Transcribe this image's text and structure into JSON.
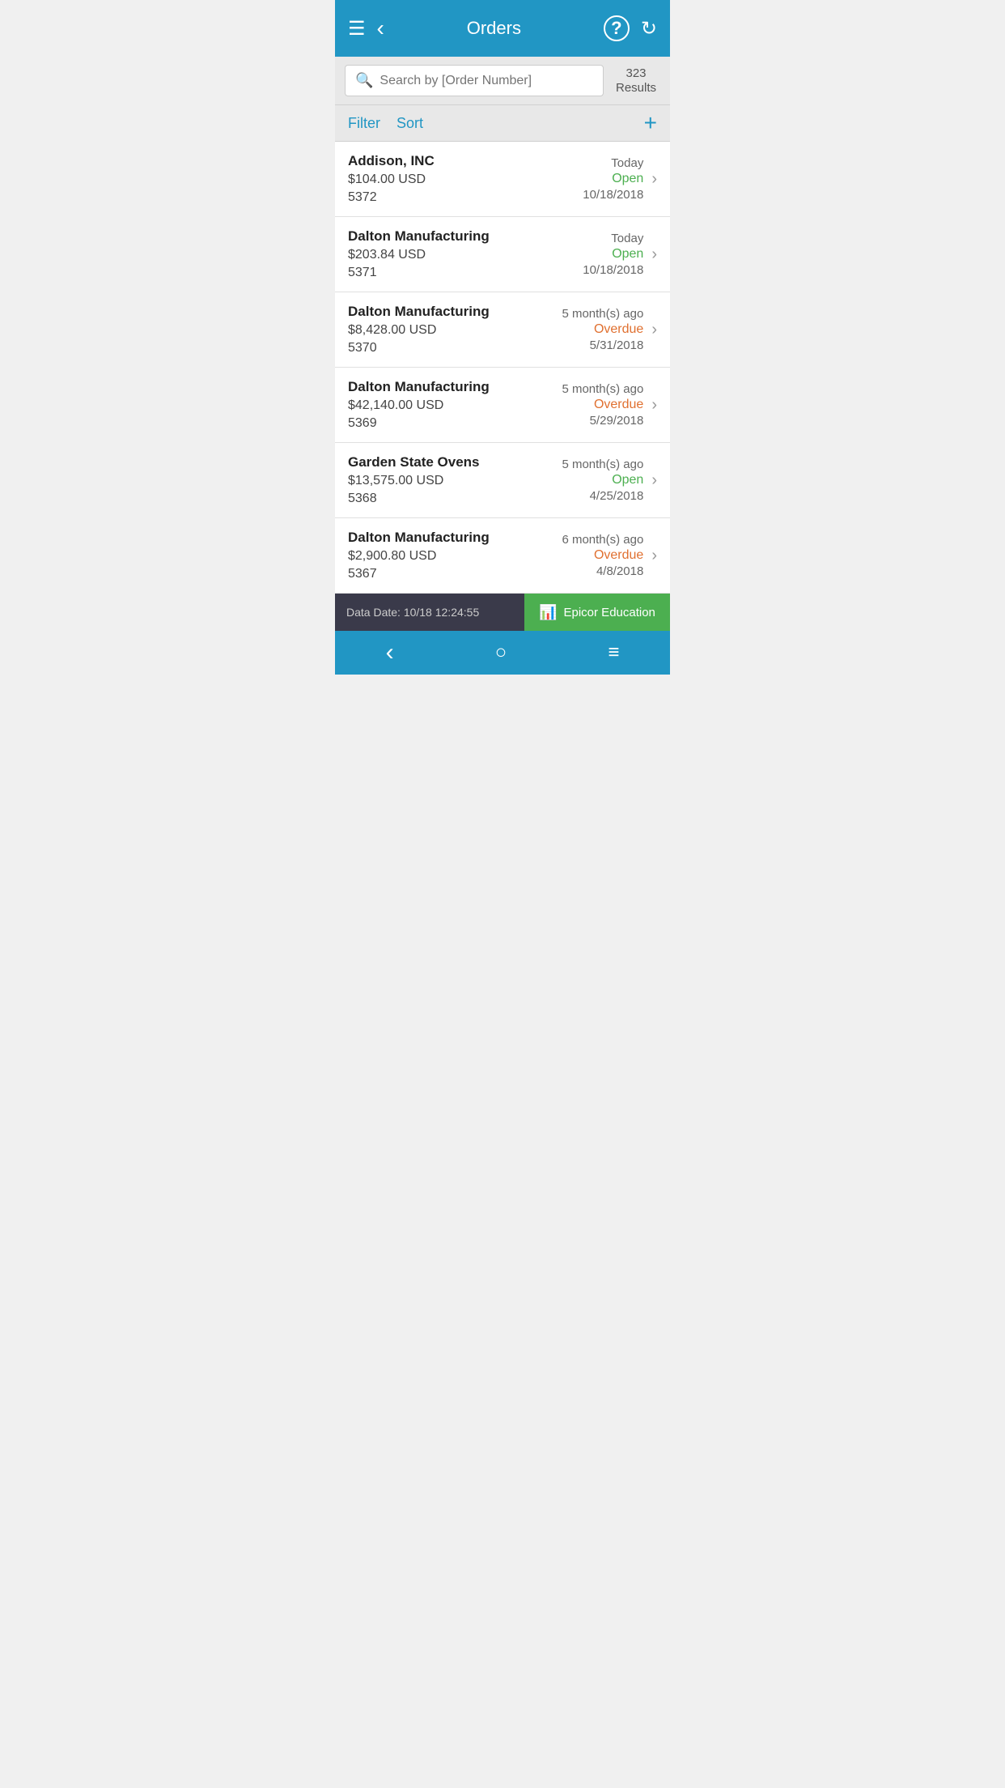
{
  "header": {
    "title": "Orders",
    "menu_icon": "☰",
    "back_icon": "‹",
    "help_icon": "?",
    "refresh_icon": "↻"
  },
  "search": {
    "placeholder": "Search by [Order Number]",
    "results_count": "323",
    "results_label": "Results"
  },
  "toolbar": {
    "filter_label": "Filter",
    "sort_label": "Sort",
    "add_label": "+"
  },
  "orders": [
    {
      "company": "Addison, INC",
      "amount": "$104.00 USD",
      "number": "5372",
      "time": "Today",
      "status": "Open",
      "status_type": "open",
      "date": "10/18/2018"
    },
    {
      "company": "Dalton Manufacturing",
      "amount": "$203.84 USD",
      "number": "5371",
      "time": "Today",
      "status": "Open",
      "status_type": "open",
      "date": "10/18/2018"
    },
    {
      "company": "Dalton Manufacturing",
      "amount": "$8,428.00 USD",
      "number": "5370",
      "time": "5 month(s) ago",
      "status": "Overdue",
      "status_type": "overdue",
      "date": "5/31/2018"
    },
    {
      "company": "Dalton Manufacturing",
      "amount": "$42,140.00 USD",
      "number": "5369",
      "time": "5 month(s) ago",
      "status": "Overdue",
      "status_type": "overdue",
      "date": "5/29/2018"
    },
    {
      "company": "Garden State Ovens",
      "amount": "$13,575.00 USD",
      "number": "5368",
      "time": "5 month(s) ago",
      "status": "Open",
      "status_type": "open",
      "date": "4/25/2018"
    },
    {
      "company": "Dalton Manufacturing",
      "amount": "$2,900.80 USD",
      "number": "5367",
      "time": "6 month(s) ago",
      "status": "Overdue",
      "status_type": "overdue",
      "date": "4/8/2018"
    }
  ],
  "footer": {
    "data_date_label": "Data Date: 10/18 12:24:55",
    "epicor_label": "Epicor Education"
  },
  "bottom_nav": {
    "back_icon": "‹",
    "home_icon": "○",
    "menu_icon": "≡"
  }
}
